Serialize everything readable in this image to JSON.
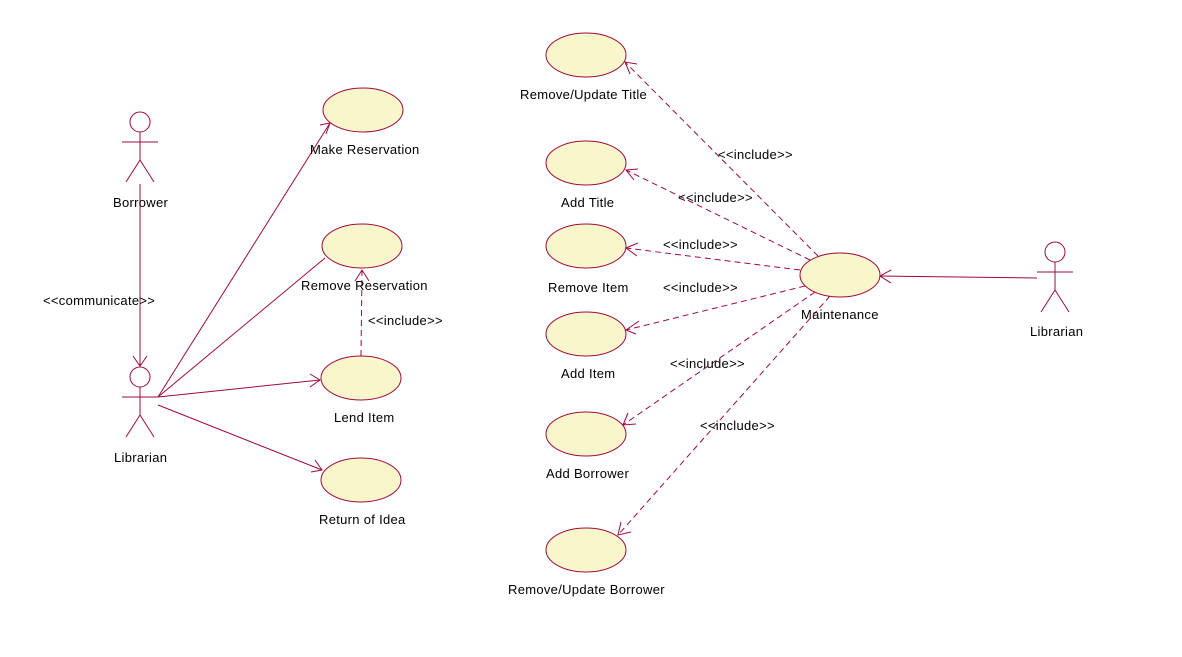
{
  "actors": {
    "borrower": {
      "label": "Borrower"
    },
    "librarian_left": {
      "label": "Librarian"
    },
    "librarian_right": {
      "label": "Librarian"
    }
  },
  "use_cases": {
    "make_reservation": {
      "label": "Make Reservation"
    },
    "remove_reservation": {
      "label": "Remove Reservation"
    },
    "lend_item": {
      "label": "Lend Item"
    },
    "return_of_idea": {
      "label": "Return of Idea"
    },
    "remove_update_title": {
      "label": "Remove/Update Title"
    },
    "add_title": {
      "label": "Add Title"
    },
    "remove_item": {
      "label": "Remove Item"
    },
    "add_item": {
      "label": "Add Item"
    },
    "add_borrower": {
      "label": "Add Borrower"
    },
    "remove_update_borrower": {
      "label": "Remove/Update Borrower"
    },
    "maintenance": {
      "label": "Maintenance"
    }
  },
  "relations": {
    "communicate": {
      "label": "<<communicate>>"
    },
    "include1": {
      "label": "<<include>>"
    },
    "include2": {
      "label": "<<include>>"
    },
    "include3": {
      "label": "<<include>>"
    },
    "include4": {
      "label": "<<include>>"
    },
    "include5": {
      "label": "<<include>>"
    },
    "include6": {
      "label": "<<include>>"
    },
    "include7": {
      "label": "<<include>>"
    }
  },
  "chart_data": {
    "type": "uml_use_case",
    "actors": [
      "Borrower",
      "Librarian",
      "Librarian"
    ],
    "use_cases": [
      "Make Reservation",
      "Remove Reservation",
      "Lend Item",
      "Return of Idea",
      "Remove/Update Title",
      "Add Title",
      "Remove Item",
      "Add Item",
      "Add Borrower",
      "Remove/Update Borrower",
      "Maintenance"
    ],
    "associations": [
      {
        "from": "Borrower",
        "to": "Librarian(left)",
        "stereotype": "communicate",
        "navigable_to": true
      },
      {
        "from": "Librarian(left)",
        "to": "Make Reservation",
        "navigable_to": true
      },
      {
        "from": "Librarian(left)",
        "to": "Remove Reservation"
      },
      {
        "from": "Librarian(left)",
        "to": "Lend Item",
        "navigable_to": true
      },
      {
        "from": "Librarian(left)",
        "to": "Return of Idea",
        "navigable_to": true
      },
      {
        "from": "Lend Item",
        "to": "Remove Reservation",
        "stereotype": "include",
        "dashed": true,
        "navigable_to": true
      },
      {
        "from": "Librarian(right)",
        "to": "Maintenance",
        "navigable_to": true
      },
      {
        "from": "Maintenance",
        "to": "Remove/Update Title",
        "stereotype": "include",
        "dashed": true,
        "navigable_to": true
      },
      {
        "from": "Maintenance",
        "to": "Add Title",
        "stereotype": "include",
        "dashed": true,
        "navigable_to": true
      },
      {
        "from": "Maintenance",
        "to": "Remove Item",
        "stereotype": "include",
        "dashed": true,
        "navigable_to": true
      },
      {
        "from": "Maintenance",
        "to": "Add Item",
        "stereotype": "include",
        "dashed": true,
        "navigable_to": true
      },
      {
        "from": "Maintenance",
        "to": "Add Borrower",
        "stereotype": "include",
        "dashed": true,
        "navigable_to": true
      },
      {
        "from": "Maintenance",
        "to": "Remove/Update Borrower",
        "stereotype": "include",
        "dashed": true,
        "navigable_to": true
      }
    ]
  }
}
